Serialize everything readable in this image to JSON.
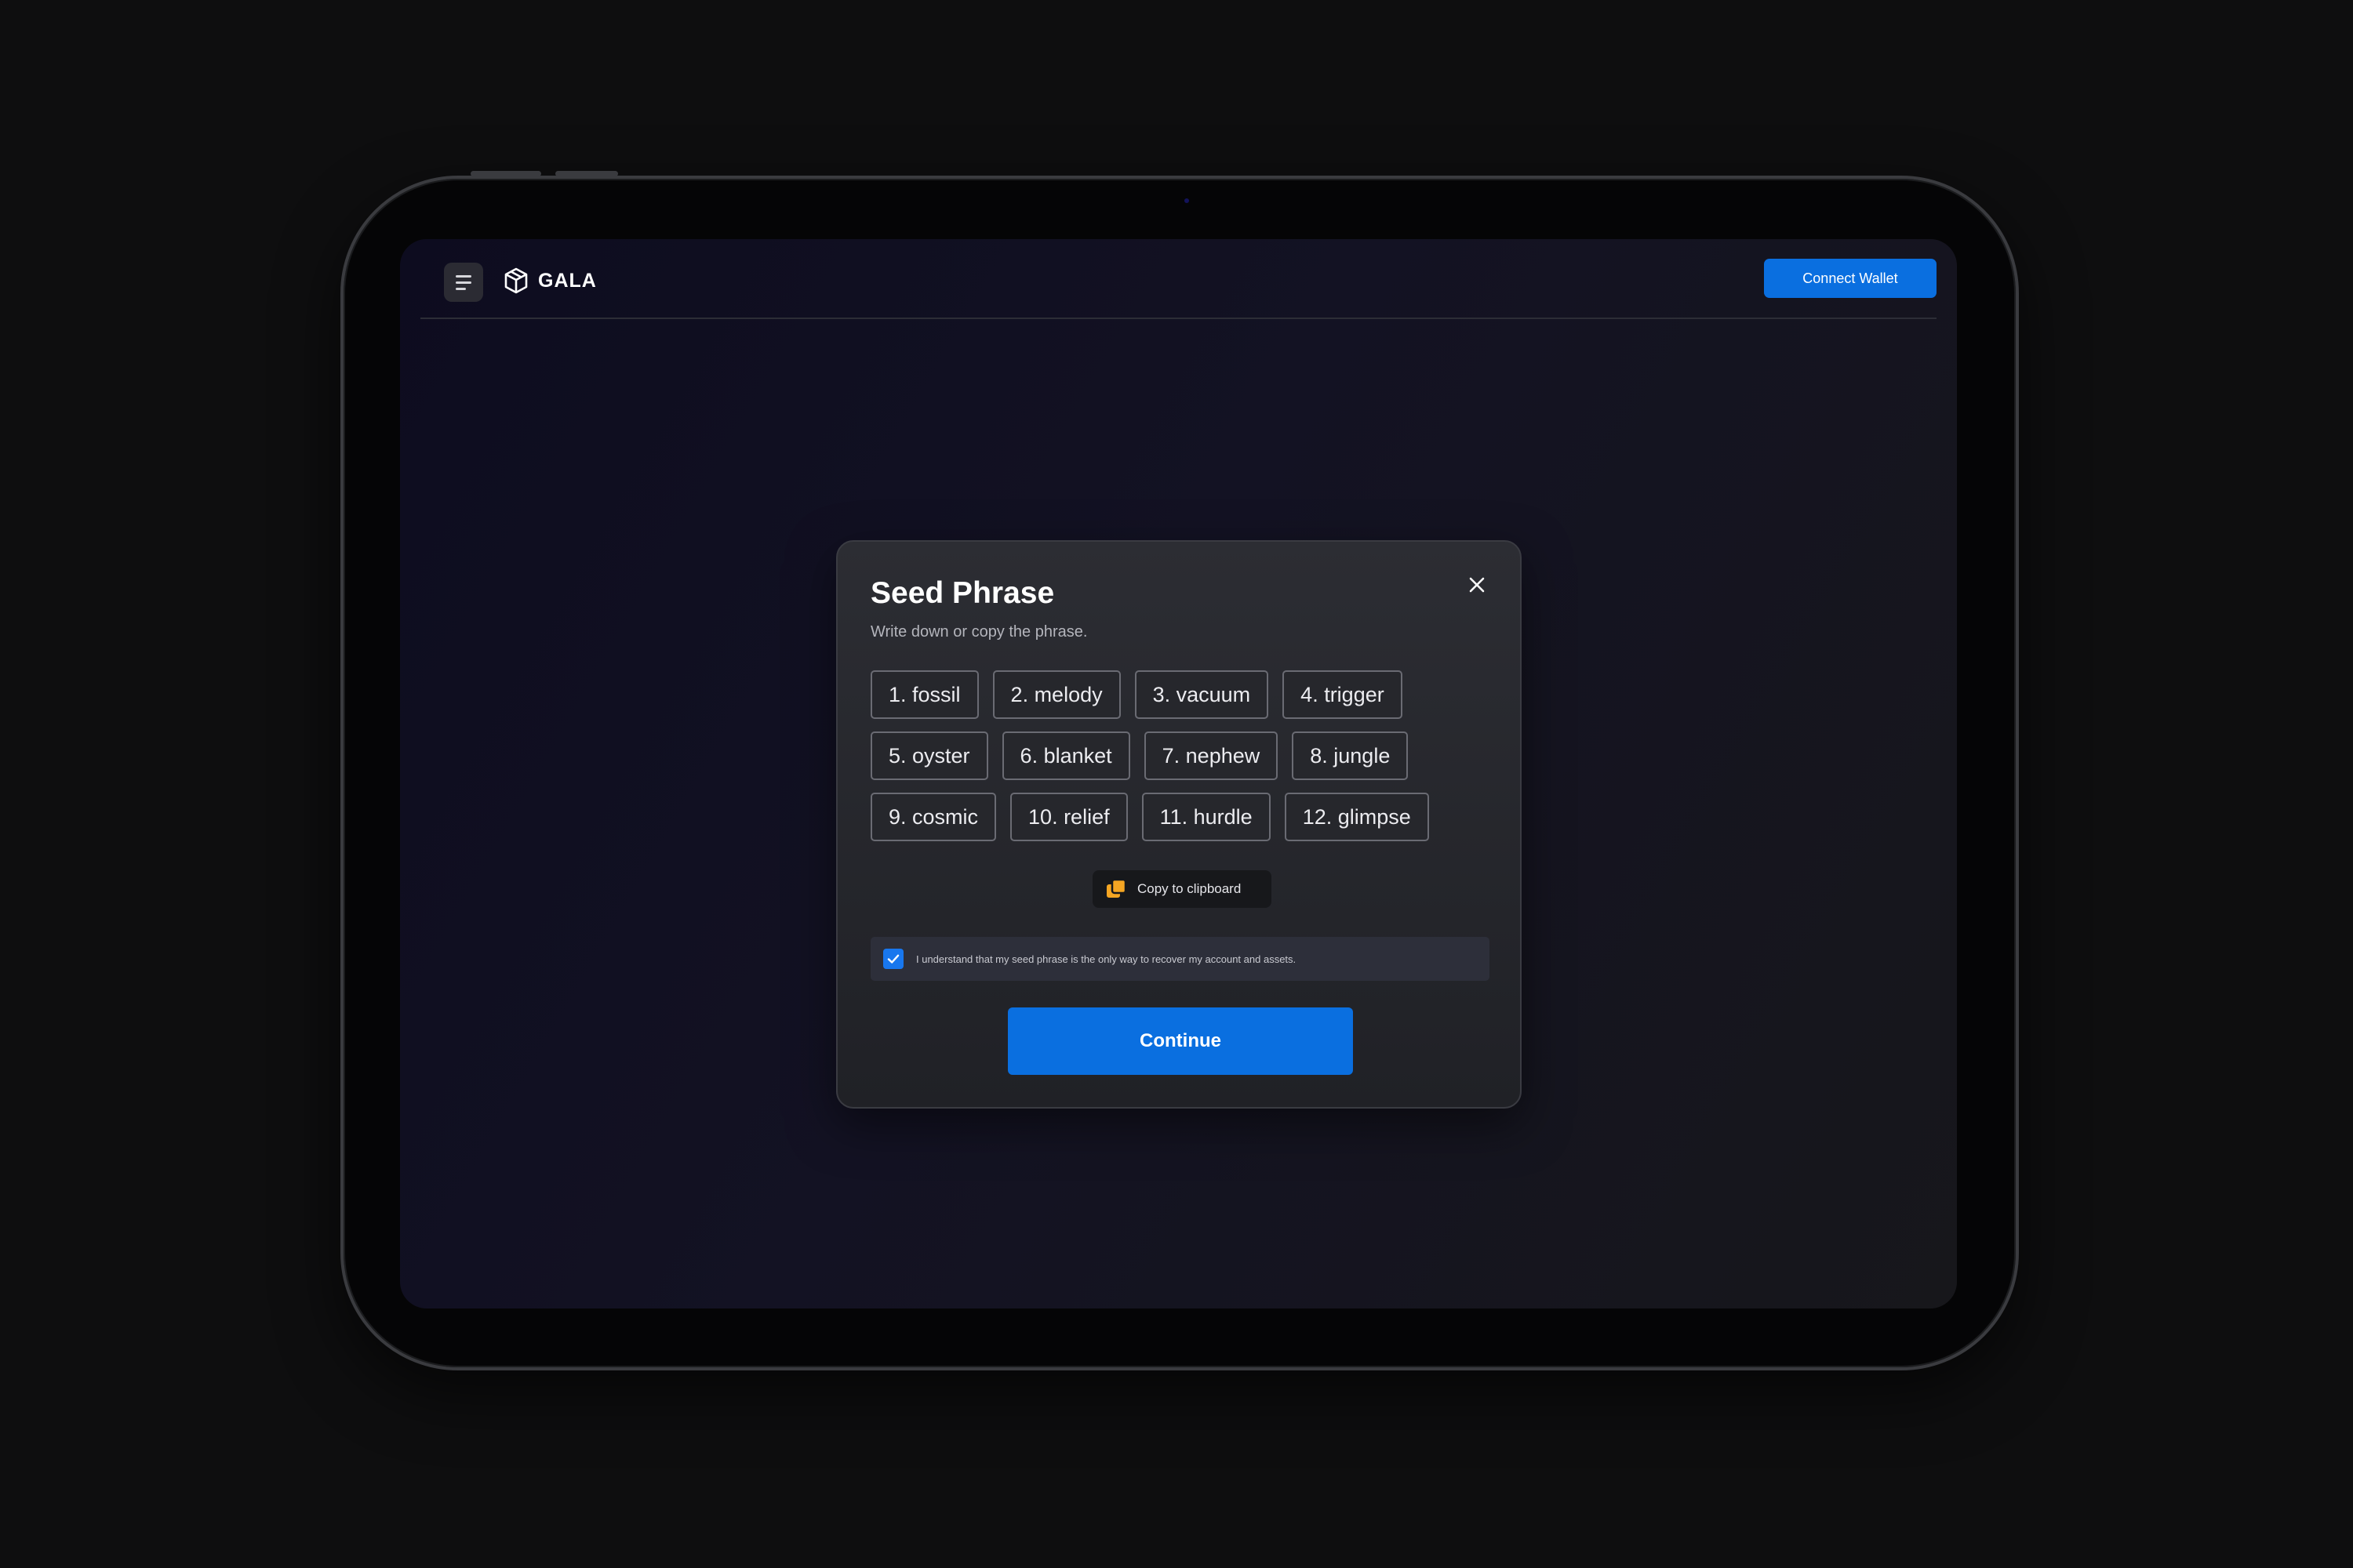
{
  "header": {
    "brand": "GALA",
    "connect_label": "Connect Wallet",
    "icons": {
      "menu": "hamburger-menu-icon",
      "logo": "gala-cube-logo"
    }
  },
  "modal": {
    "title": "Seed Phrase",
    "subtitle": "Write down or copy the phrase.",
    "words": [
      [
        "1. fossil",
        "2. melody",
        "3. vacuum",
        "4. trigger"
      ],
      [
        "5. oyster",
        "6. blanket",
        "7. nephew",
        "8. jungle"
      ],
      [
        "9. cosmic",
        "10. relief",
        "11. hurdle",
        "12. glimpse"
      ]
    ],
    "copy_label": "Copy to clipboard",
    "agree_text": "I understand that my seed phrase is the only way to recover my account and assets.",
    "agree_checked": true,
    "continue_label": "Continue"
  },
  "colors": {
    "accent": "#0a6fe0",
    "copy_icon": "#f5a623",
    "background": "#0e0e0f"
  }
}
